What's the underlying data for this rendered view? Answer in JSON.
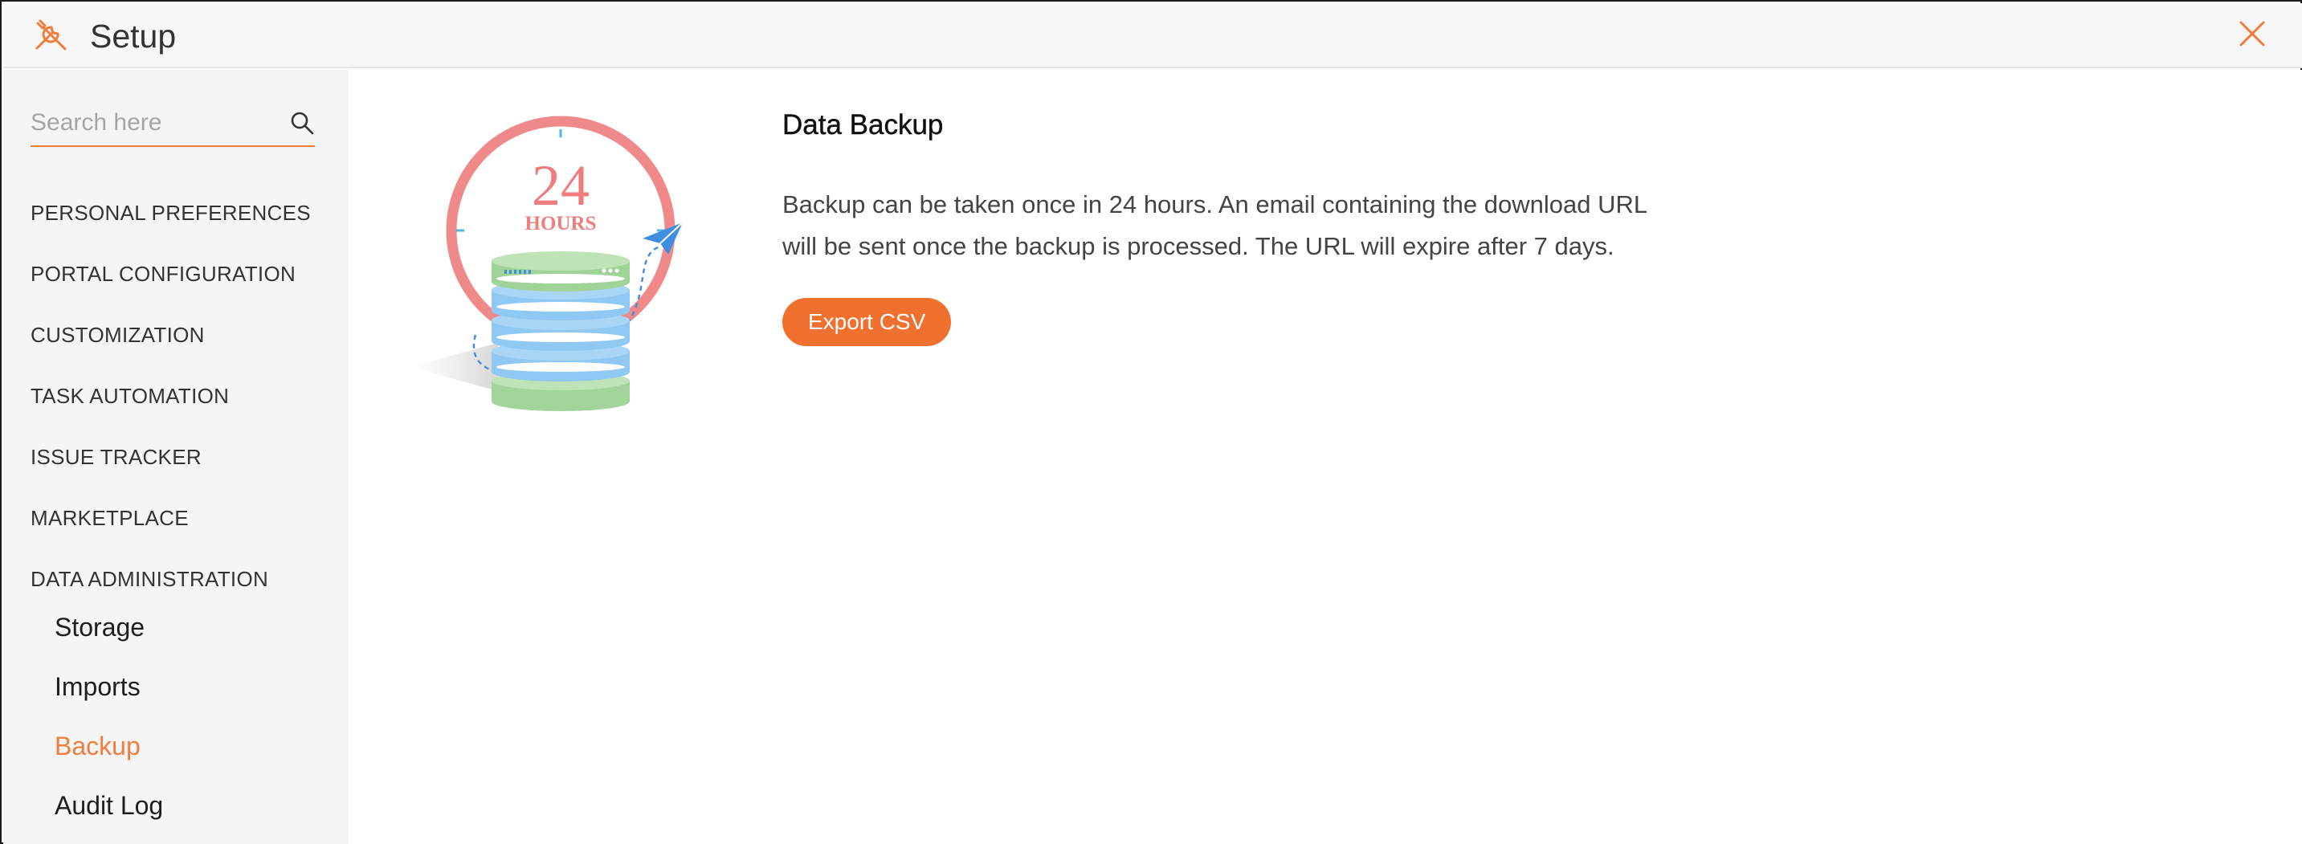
{
  "header": {
    "title": "Setup",
    "logo_icon": "tools-icon",
    "close_icon": "close-icon",
    "accent_color": "#f07d3b"
  },
  "sidebar": {
    "search": {
      "placeholder": "Search here",
      "value": "",
      "icon": "search-icon"
    },
    "items": [
      {
        "label": "PERSONAL PREFERENCES"
      },
      {
        "label": "PORTAL CONFIGURATION"
      },
      {
        "label": "CUSTOMIZATION"
      },
      {
        "label": "TASK AUTOMATION"
      },
      {
        "label": "ISSUE TRACKER"
      },
      {
        "label": "MARKETPLACE"
      },
      {
        "label": "DATA ADMINISTRATION"
      }
    ],
    "sub_items": [
      {
        "label": "Storage",
        "active": false
      },
      {
        "label": "Imports",
        "active": false
      },
      {
        "label": "Backup",
        "active": true
      },
      {
        "label": "Audit Log",
        "active": false
      }
    ]
  },
  "main": {
    "illustration": {
      "number": "24",
      "unit": "HOURS",
      "icon": "database-backup-illustration"
    },
    "title": "Data Backup",
    "description": "Backup can be taken once in 24 hours. An email containing the download URL will be sent once the backup is processed. The URL will expire after 7 days.",
    "export_button": "Export CSV",
    "button_color": "#f0702f"
  }
}
